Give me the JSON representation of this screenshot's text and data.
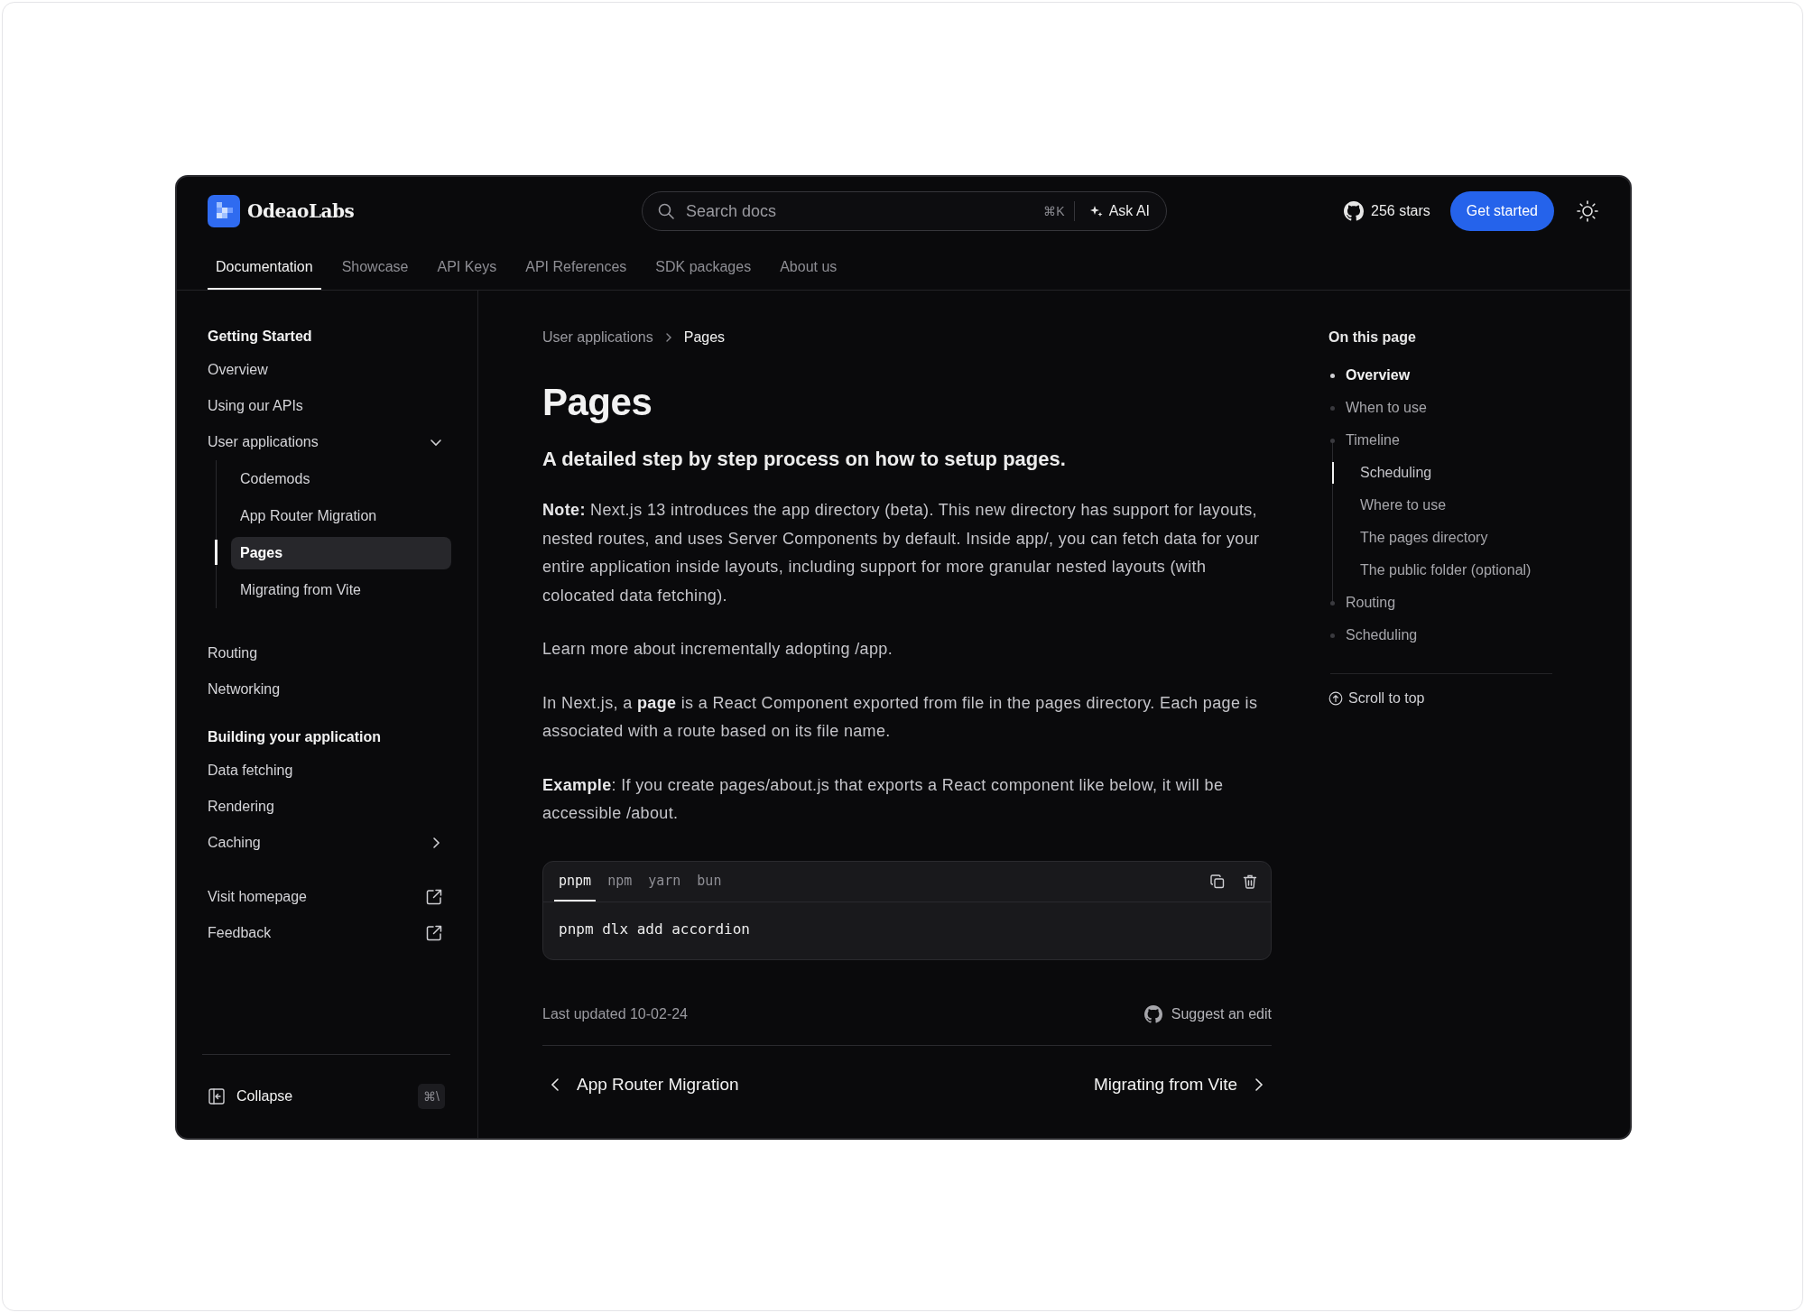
{
  "brand": {
    "name": "OdeaoLabs"
  },
  "search": {
    "placeholder": "Search docs",
    "shortcut": "⌘K",
    "ask_ai": "Ask AI"
  },
  "github": {
    "stars": "256 stars"
  },
  "get_started": "Get started",
  "nav_tabs": [
    {
      "label": "Documentation",
      "selected": true
    },
    {
      "label": "Showcase",
      "selected": false
    },
    {
      "label": "API Keys",
      "selected": false
    },
    {
      "label": "API References",
      "selected": false
    },
    {
      "label": "SDK packages",
      "selected": false
    },
    {
      "label": "About us",
      "selected": false
    }
  ],
  "sidebar": {
    "sections": [
      {
        "heading": "Getting Started",
        "items": [
          {
            "label": "Overview",
            "kind": "link",
            "selected": false
          },
          {
            "label": "Using our APIs",
            "kind": "link",
            "selected": false
          },
          {
            "label": "User applications",
            "kind": "group",
            "expanded": true,
            "children": [
              {
                "label": "Codemods",
                "selected": false
              },
              {
                "label": "App Router Migration",
                "selected": false
              },
              {
                "label": "Pages",
                "selected": true
              },
              {
                "label": "Migrating from Vite",
                "selected": false
              }
            ]
          },
          {
            "label": "Routing",
            "kind": "link",
            "selected": false
          },
          {
            "label": "Networking",
            "kind": "link",
            "selected": false
          }
        ]
      },
      {
        "heading": "Building your application",
        "items": [
          {
            "label": "Data fetching",
            "kind": "link",
            "selected": false
          },
          {
            "label": "Rendering",
            "kind": "link",
            "selected": false
          },
          {
            "label": "Caching",
            "kind": "group",
            "expanded": false
          }
        ]
      },
      {
        "items": [
          {
            "label": "Visit homepage",
            "kind": "external",
            "selected": false
          },
          {
            "label": "Feedback",
            "kind": "external",
            "selected": false
          }
        ]
      }
    ],
    "collapse": {
      "label": "Collapse",
      "shortcut": "⌘\\"
    }
  },
  "breadcrumb": [
    "User applications",
    "Pages"
  ],
  "title": "Pages",
  "subtitle": "A detailed step by step process on how to setup pages.",
  "paragraphs": [
    "**Note:** Next.js 13 introduces the app directory (beta). This new directory has support for layouts, nested routes, and uses Server Components by default. Inside app/, you can fetch data for your entire application inside layouts, including support for more granular nested layouts (with colocated data fetching).",
    "Learn more about incrementally adopting /app.",
    "In Next.js, a **page** is a React Component exported from file in the pages directory. Each page is associated with a route based on its file name.",
    "**Example**: If you create pages/about.js that exports a React component like below, it will be accessible /about."
  ],
  "code_block": {
    "tabs": [
      {
        "label": "pnpm",
        "selected": true
      },
      {
        "label": "npm",
        "selected": false
      },
      {
        "label": "yarn",
        "selected": false
      },
      {
        "label": "bun",
        "selected": false
      }
    ],
    "code": "pnpm dlx add accordion"
  },
  "last_updated": "Last updated 10-02-24",
  "suggest_edit": "Suggest an edit",
  "pager": {
    "previous": "App Router Migration",
    "next": "Migrating from Vite"
  },
  "toc": {
    "title": "On this page",
    "items": [
      {
        "label": "Overview",
        "selected": true
      },
      {
        "label": "When to use",
        "selected": false
      },
      {
        "label": "Timeline",
        "selected": false,
        "children": [
          {
            "label": "Scheduling",
            "selected": true
          },
          {
            "label": "Where to use",
            "selected": false
          },
          {
            "label": "The pages directory",
            "selected": false
          },
          {
            "label": "The public folder (optional)",
            "selected": false
          }
        ]
      },
      {
        "label": "Routing",
        "selected": false
      },
      {
        "label": "Scheduling",
        "selected": false
      }
    ],
    "scroll_top": "Scroll to top"
  }
}
